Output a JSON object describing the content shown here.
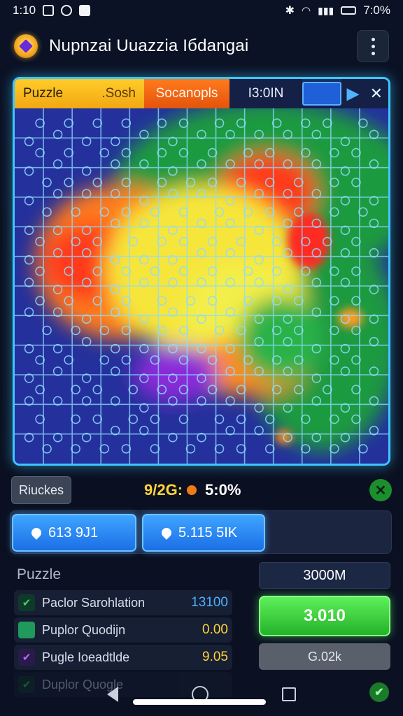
{
  "status_bar": {
    "time": "1:10",
    "battery_text": "7:0%"
  },
  "app_bar": {
    "title": "Nupnzai Uuazzia Iбdangai"
  },
  "board_tabs": {
    "puzzle_label": "Puzzle",
    "puzzle_sub": ".Sosh",
    "score_label": "Socanopls",
    "time_label": "I3:0IN",
    "play_glyph": "▶",
    "close_glyph": "✕"
  },
  "board": {
    "rows": 12,
    "cols": 13,
    "colors": {
      "blue": "#2c3ab0",
      "green": "#1f9a3f",
      "yellow": "#f6e53a",
      "orange": "#ff8a1c",
      "red": "#ff3b1e",
      "purple": "#8a2ad8",
      "grid": "#8fdcff"
    }
  },
  "controls": {
    "left_button": "Riuckes",
    "stat_prefix": "9/2G:",
    "stat_value": "5:0%"
  },
  "pills": [
    {
      "label": "613 9J1"
    },
    {
      "label": "5.115 5IK"
    }
  ],
  "section": {
    "label": "Puzzle"
  },
  "list": [
    {
      "label": "Paclor Sarohlation",
      "value": "13100",
      "value_color": "#4fb0ff",
      "check_color": "#2aa84a"
    },
    {
      "label": "Puplor Quodijn",
      "value": "0.00",
      "value_color": "#ffd23a",
      "check_color": "#1f9a5a"
    },
    {
      "label": "Pugle Ioeadtlde",
      "value": "9.05",
      "value_color": "#ffd23a",
      "check_color": "#9a3ae0"
    },
    {
      "label": "Duplor Quogle",
      "value": "",
      "value_color": "#ffd23a",
      "check_color": "#1f7a3a"
    }
  ],
  "right_column": {
    "top_label": "3000M",
    "primary_button": "3.010",
    "secondary_button": "G.02k"
  }
}
